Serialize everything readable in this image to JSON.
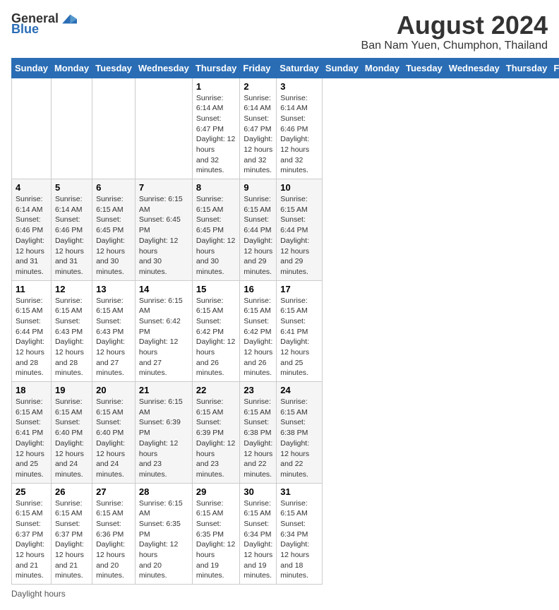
{
  "header": {
    "logo_general": "General",
    "logo_blue": "Blue",
    "title": "August 2024",
    "subtitle": "Ban Nam Yuen, Chumphon, Thailand"
  },
  "days_of_week": [
    "Sunday",
    "Monday",
    "Tuesday",
    "Wednesday",
    "Thursday",
    "Friday",
    "Saturday"
  ],
  "weeks": [
    [
      {
        "day": "",
        "info": ""
      },
      {
        "day": "",
        "info": ""
      },
      {
        "day": "",
        "info": ""
      },
      {
        "day": "",
        "info": ""
      },
      {
        "day": "1",
        "info": "Sunrise: 6:14 AM\nSunset: 6:47 PM\nDaylight: 12 hours\nand 32 minutes."
      },
      {
        "day": "2",
        "info": "Sunrise: 6:14 AM\nSunset: 6:47 PM\nDaylight: 12 hours\nand 32 minutes."
      },
      {
        "day": "3",
        "info": "Sunrise: 6:14 AM\nSunset: 6:46 PM\nDaylight: 12 hours\nand 32 minutes."
      }
    ],
    [
      {
        "day": "4",
        "info": "Sunrise: 6:14 AM\nSunset: 6:46 PM\nDaylight: 12 hours\nand 31 minutes."
      },
      {
        "day": "5",
        "info": "Sunrise: 6:14 AM\nSunset: 6:46 PM\nDaylight: 12 hours\nand 31 minutes."
      },
      {
        "day": "6",
        "info": "Sunrise: 6:15 AM\nSunset: 6:45 PM\nDaylight: 12 hours\nand 30 minutes."
      },
      {
        "day": "7",
        "info": "Sunrise: 6:15 AM\nSunset: 6:45 PM\nDaylight: 12 hours\nand 30 minutes."
      },
      {
        "day": "8",
        "info": "Sunrise: 6:15 AM\nSunset: 6:45 PM\nDaylight: 12 hours\nand 30 minutes."
      },
      {
        "day": "9",
        "info": "Sunrise: 6:15 AM\nSunset: 6:44 PM\nDaylight: 12 hours\nand 29 minutes."
      },
      {
        "day": "10",
        "info": "Sunrise: 6:15 AM\nSunset: 6:44 PM\nDaylight: 12 hours\nand 29 minutes."
      }
    ],
    [
      {
        "day": "11",
        "info": "Sunrise: 6:15 AM\nSunset: 6:44 PM\nDaylight: 12 hours\nand 28 minutes."
      },
      {
        "day": "12",
        "info": "Sunrise: 6:15 AM\nSunset: 6:43 PM\nDaylight: 12 hours\nand 28 minutes."
      },
      {
        "day": "13",
        "info": "Sunrise: 6:15 AM\nSunset: 6:43 PM\nDaylight: 12 hours\nand 27 minutes."
      },
      {
        "day": "14",
        "info": "Sunrise: 6:15 AM\nSunset: 6:42 PM\nDaylight: 12 hours\nand 27 minutes."
      },
      {
        "day": "15",
        "info": "Sunrise: 6:15 AM\nSunset: 6:42 PM\nDaylight: 12 hours\nand 26 minutes."
      },
      {
        "day": "16",
        "info": "Sunrise: 6:15 AM\nSunset: 6:42 PM\nDaylight: 12 hours\nand 26 minutes."
      },
      {
        "day": "17",
        "info": "Sunrise: 6:15 AM\nSunset: 6:41 PM\nDaylight: 12 hours\nand 25 minutes."
      }
    ],
    [
      {
        "day": "18",
        "info": "Sunrise: 6:15 AM\nSunset: 6:41 PM\nDaylight: 12 hours\nand 25 minutes."
      },
      {
        "day": "19",
        "info": "Sunrise: 6:15 AM\nSunset: 6:40 PM\nDaylight: 12 hours\nand 24 minutes."
      },
      {
        "day": "20",
        "info": "Sunrise: 6:15 AM\nSunset: 6:40 PM\nDaylight: 12 hours\nand 24 minutes."
      },
      {
        "day": "21",
        "info": "Sunrise: 6:15 AM\nSunset: 6:39 PM\nDaylight: 12 hours\nand 23 minutes."
      },
      {
        "day": "22",
        "info": "Sunrise: 6:15 AM\nSunset: 6:39 PM\nDaylight: 12 hours\nand 23 minutes."
      },
      {
        "day": "23",
        "info": "Sunrise: 6:15 AM\nSunset: 6:38 PM\nDaylight: 12 hours\nand 22 minutes."
      },
      {
        "day": "24",
        "info": "Sunrise: 6:15 AM\nSunset: 6:38 PM\nDaylight: 12 hours\nand 22 minutes."
      }
    ],
    [
      {
        "day": "25",
        "info": "Sunrise: 6:15 AM\nSunset: 6:37 PM\nDaylight: 12 hours\nand 21 minutes."
      },
      {
        "day": "26",
        "info": "Sunrise: 6:15 AM\nSunset: 6:37 PM\nDaylight: 12 hours\nand 21 minutes."
      },
      {
        "day": "27",
        "info": "Sunrise: 6:15 AM\nSunset: 6:36 PM\nDaylight: 12 hours\nand 20 minutes."
      },
      {
        "day": "28",
        "info": "Sunrise: 6:15 AM\nSunset: 6:35 PM\nDaylight: 12 hours\nand 20 minutes."
      },
      {
        "day": "29",
        "info": "Sunrise: 6:15 AM\nSunset: 6:35 PM\nDaylight: 12 hours\nand 19 minutes."
      },
      {
        "day": "30",
        "info": "Sunrise: 6:15 AM\nSunset: 6:34 PM\nDaylight: 12 hours\nand 19 minutes."
      },
      {
        "day": "31",
        "info": "Sunrise: 6:15 AM\nSunset: 6:34 PM\nDaylight: 12 hours\nand 18 minutes."
      }
    ]
  ],
  "footer": {
    "note": "Daylight hours"
  }
}
